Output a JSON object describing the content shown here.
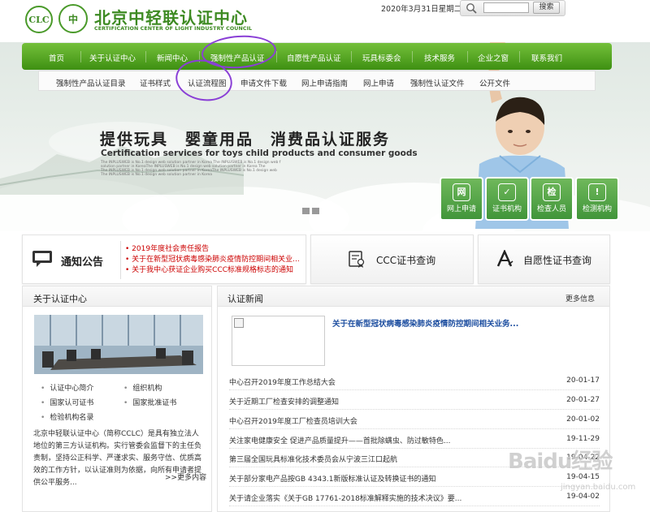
{
  "header": {
    "logo_clc": "CLC",
    "logo_mark": "中",
    "title": "北京中轻联认证中心",
    "subtitle": "CERTIFICATION CENTER OF LIGHT INDUSTRY COUNCIL",
    "date": "2020年3月31日星期二",
    "search_button": "搜索",
    "search_value": ""
  },
  "main_nav": {
    "items": [
      "首页",
      "关于认证中心",
      "新闻中心",
      "强制性产品认证",
      "自愿性产品认证",
      "玩具标委会",
      "技术服务",
      "企业之窗",
      "联系我们"
    ]
  },
  "sub_nav": {
    "items": [
      "强制性产品认证目录",
      "证书样式",
      "认证流程图",
      "申请文件下载",
      "网上申请指南",
      "网上申请",
      "强制性认证文件",
      "公开文件"
    ]
  },
  "hero": {
    "title": "提供玩具　婴童用品　消费品认证服务",
    "subtitle": "Certification services for toys child products and consumer goods",
    "small_lines": [
      "The INPLUSWEB is No.1 design web solution partner in Korea The INPLUSWEB is No.1 design web f",
      "solution partner in KoreaThe INPLUSWEB is No.1 design web solution partner in Korea The",
      "The INPLUSWEB is No.1 design web solution partner in KoreaThe INPLUSWEB is No.1 design web",
      "The INPLUSWEB is No.1 design web solution partner in Korea"
    ]
  },
  "quick_links": [
    {
      "icon": "网",
      "label": "网上申请",
      "icon_name": "web-icon"
    },
    {
      "icon": "✓",
      "label": "证书机构",
      "icon_name": "shield-check-icon"
    },
    {
      "icon": "检",
      "label": "检查人员",
      "icon_name": "inspector-icon"
    },
    {
      "icon": "!",
      "label": "检测机构",
      "icon_name": "alert-shield-icon"
    }
  ],
  "notice": {
    "title": "通知公告",
    "links": [
      "2019年度社会责任报告",
      "关于在新型冠状病毒感染肺炎疫情防控期间相关业...",
      "关于我中心获证企业购买CCC标准规格标志的通知"
    ]
  },
  "cert_panels": [
    {
      "label": "CCC证书查询"
    },
    {
      "label": "自愿性证书查询"
    }
  ],
  "about": {
    "header": "关于认证中心",
    "links": [
      "认证中心简介",
      "组织机构",
      "国家认可证书",
      "国家批准证书",
      "检验机构名录"
    ],
    "text": "北京中轻联认证中心（简称CCLC）是具有独立法人地位的第三方认证机构。实行管委会监督下的主任负责制，坚持公正科学、严谨求实、服务守信、优质高效的工作方针，以认证准则为依据，向所有申请者提供公平服务...",
    "more": ">>更多内容"
  },
  "news": {
    "header": "认证新闻",
    "more": "更多信息",
    "feature_title": "关于在新型冠状病毒感染肺炎疫情防控期间相关业务...",
    "items": [
      {
        "title": "中心召开2019年度工作总结大会",
        "date": "20-01-17"
      },
      {
        "title": "关于近期工厂检查安排的调整通知",
        "date": "20-01-27"
      },
      {
        "title": "中心召开2019年度工厂检查员培训大会",
        "date": "20-01-02"
      },
      {
        "title": "关注家电健康安全 促进产品质量提升——首批除螨虫、防过敏特色...",
        "date": "19-11-29"
      },
      {
        "title": "第三届全国玩具标准化技术委员会从宁波三江口起航",
        "date": "19-04-22"
      },
      {
        "title": "关于部分家电产品按GB 4343.1新版标准认证及转换证书的通知",
        "date": "19-04-15"
      },
      {
        "title": "关于请企业落实《关于GB 17761-2018标准解释实施的技术决议》要...",
        "date": "19-04-02"
      }
    ]
  },
  "watermark": {
    "brand": "Baidu经验",
    "url": "jingyan.baidu.com"
  },
  "colors": {
    "brand_green": "#3d8a22",
    "nav_green": "#5aa82a",
    "link_blue": "#1d4ea0",
    "notice_red": "#c00000",
    "annotation_purple": "#8a3fd6"
  }
}
